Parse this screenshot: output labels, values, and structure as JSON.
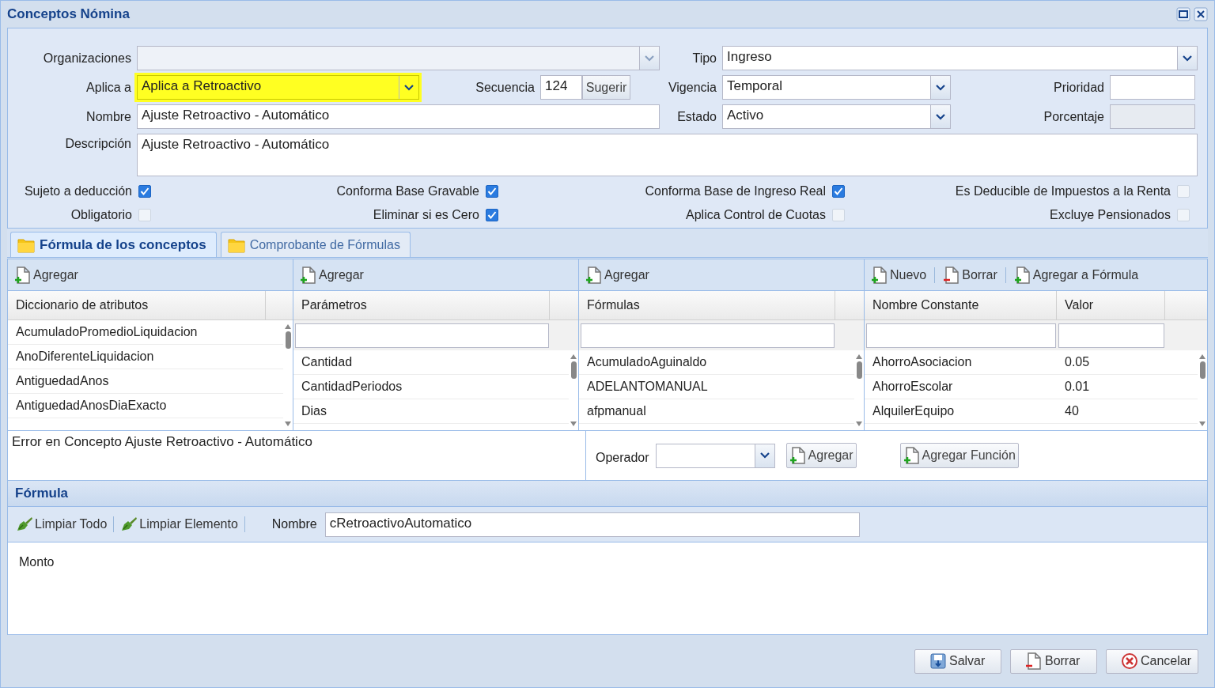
{
  "window": {
    "title": "Conceptos Nómina"
  },
  "form": {
    "organizaciones": {
      "label": "Organizaciones"
    },
    "tipo": {
      "label": "Tipo",
      "value": "Ingreso"
    },
    "aplica_a": {
      "label": "Aplica a",
      "value": "Aplica a Retroactivo",
      "highlighted": true
    },
    "secuencia": {
      "label": "Secuencia",
      "value": "124",
      "button": "Sugerir"
    },
    "vigencia": {
      "label": "Vigencia",
      "value": "Temporal"
    },
    "prioridad": {
      "label": "Prioridad"
    },
    "nombre": {
      "label": "Nombre",
      "value": "Ajuste Retroactivo - Automático"
    },
    "estado": {
      "label": "Estado",
      "value": "Activo"
    },
    "porcentaje": {
      "label": "Porcentaje",
      "disabled": true
    },
    "descripcion": {
      "label": "Descripción",
      "value": "Ajuste Retroactivo - Automático"
    }
  },
  "checkboxes": [
    {
      "label": "Sujeto a deducción",
      "checked": true
    },
    {
      "label": "Conforma Base Gravable",
      "checked": true
    },
    {
      "label": "Conforma Base de Ingreso Real",
      "checked": true
    },
    {
      "label": "Es Deducible de Impuestos a la Renta",
      "checked": false
    },
    {
      "label": "Obligatorio",
      "checked": false
    },
    {
      "label": "Eliminar si es Cero",
      "checked": true
    },
    {
      "label": "Aplica Control de Cuotas",
      "checked": false
    },
    {
      "label": "Excluye Pensionados",
      "checked": false
    }
  ],
  "tabs": [
    {
      "label": "Fórmula de los conceptos",
      "selected": true
    },
    {
      "label": "Comprobante de Fórmulas",
      "selected": false
    }
  ],
  "panels": [
    {
      "toolbar": [
        {
          "label": "Agregar",
          "kind": "add"
        }
      ],
      "columns": [
        "Diccionario de atributos"
      ],
      "filter": false,
      "rows": [
        [
          "AcumuladoPromedioLiquidacion"
        ],
        [
          "AnoDiferenteLiquidacion"
        ],
        [
          "AntiguedadAnos"
        ],
        [
          "AntiguedadAnosDiaExacto"
        ]
      ]
    },
    {
      "toolbar": [
        {
          "label": "Agregar",
          "kind": "add"
        }
      ],
      "columns": [
        "Parámetros"
      ],
      "filter": true,
      "rows": [
        [
          "Cantidad"
        ],
        [
          "CantidadPeriodos"
        ],
        [
          "Dias"
        ]
      ]
    },
    {
      "toolbar": [
        {
          "label": "Agregar",
          "kind": "add"
        }
      ],
      "columns": [
        "Fórmulas"
      ],
      "filter": true,
      "rows": [
        [
          "AcumuladoAguinaldo"
        ],
        [
          "ADELANTOMANUAL"
        ],
        [
          "afpmanual"
        ]
      ]
    },
    {
      "toolbar": [
        {
          "label": "Nuevo",
          "kind": "add"
        },
        {
          "label": "Borrar",
          "kind": "delete"
        },
        {
          "label": "Agregar a Fórmula",
          "kind": "add"
        }
      ],
      "columns": [
        "Nombre Constante",
        "Valor"
      ],
      "filter": true,
      "rows": [
        [
          "AhorroAsociacion",
          "0.05"
        ],
        [
          "AhorroEscolar",
          "0.01"
        ],
        [
          "AlquilerEquipo",
          "40"
        ]
      ]
    }
  ],
  "error_message": "Error en Concepto Ajuste Retroactivo - Automático",
  "operator": {
    "label": "Operador",
    "buttons": [
      "Agregar",
      "Agregar Función"
    ]
  },
  "formula": {
    "title": "Fórmula",
    "tools": [
      "Limpiar Todo",
      "Limpiar Elemento"
    ],
    "name_label": "Nombre",
    "name_value": "cRetroactivoAutomatico",
    "content": "Monto"
  },
  "footer_buttons": [
    {
      "label": "Salvar",
      "kind": "save"
    },
    {
      "label": "Borrar",
      "kind": "delete"
    },
    {
      "label": "Cancelar",
      "kind": "cancel"
    }
  ]
}
